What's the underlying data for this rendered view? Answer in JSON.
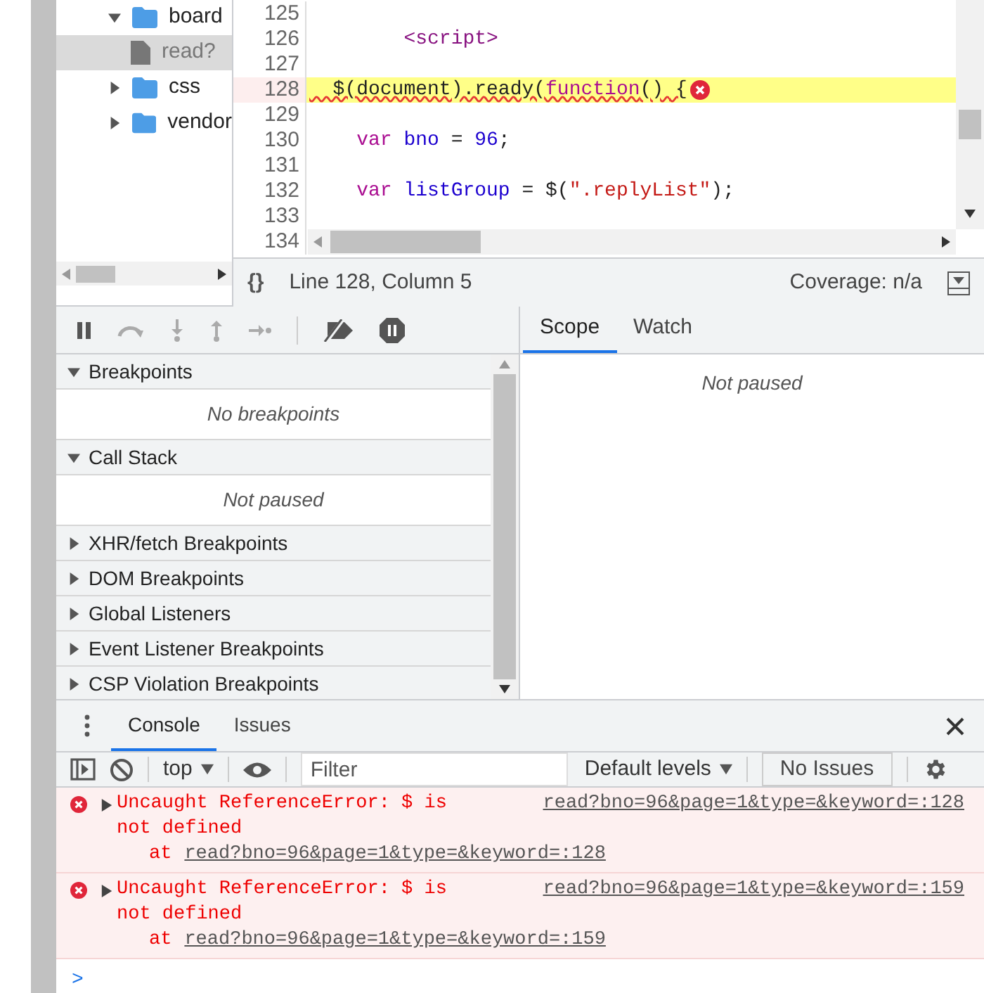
{
  "navigator": {
    "tree": [
      {
        "label": "board",
        "kind": "folder",
        "expanded": true,
        "selected": false,
        "children": [
          {
            "label": "read?",
            "kind": "file",
            "selected": true
          }
        ]
      },
      {
        "label": "css",
        "kind": "folder",
        "expanded": false,
        "selected": false
      },
      {
        "label": "vendor",
        "kind": "folder",
        "expanded": false,
        "selected": false
      }
    ]
  },
  "editor": {
    "lines": [
      {
        "number": "125",
        "highlighted": false
      },
      {
        "number": "126",
        "tokens": [
          {
            "text": "        <script>",
            "kind": "tag"
          }
        ],
        "highlighted": false
      },
      {
        "number": "127",
        "highlighted": false
      },
      {
        "number": "128",
        "tokens": [
          {
            "text": "  $(document).ready(",
            "kind": "plain"
          },
          {
            "text": "function",
            "kind": "keyword"
          },
          {
            "text": "() {",
            "kind": "plain"
          }
        ],
        "highlighted": true,
        "error": true
      },
      {
        "number": "129",
        "highlighted": false
      },
      {
        "number": "130",
        "tokens": [
          {
            "text": "    var",
            "kind": "keyword"
          },
          {
            "text": " bno",
            "kind": "variable"
          },
          {
            "text": " = ",
            "kind": "plain"
          },
          {
            "text": "96",
            "kind": "number"
          },
          {
            "text": ";",
            "kind": "plain"
          }
        ],
        "highlighted": false
      },
      {
        "number": "131",
        "highlighted": false
      },
      {
        "number": "132",
        "tokens": [
          {
            "text": "    var",
            "kind": "keyword"
          },
          {
            "text": " listGroup",
            "kind": "variable"
          },
          {
            "text": " = $(",
            "kind": "plain"
          },
          {
            "text": "\".replyList\"",
            "kind": "string"
          },
          {
            "text": ");",
            "kind": "plain"
          }
        ],
        "highlighted": false
      },
      {
        "number": "133",
        "highlighted": false
      },
      {
        "number": "134",
        "highlighted": false
      }
    ]
  },
  "status_bar": {
    "pretty_print": "{}",
    "position": "Line 128, Column 5",
    "coverage": "Coverage: n/a"
  },
  "debugger": {
    "sections": [
      {
        "title": "Breakpoints",
        "expanded": true,
        "body": "No breakpoints"
      },
      {
        "title": "Call Stack",
        "expanded": true,
        "body": "Not paused"
      },
      {
        "title": "XHR/fetch Breakpoints",
        "expanded": false
      },
      {
        "title": "DOM Breakpoints",
        "expanded": false
      },
      {
        "title": "Global Listeners",
        "expanded": false
      },
      {
        "title": "Event Listener Breakpoints",
        "expanded": false
      },
      {
        "title": "CSP Violation Breakpoints",
        "expanded": false
      }
    ]
  },
  "sidebar_tabs": [
    {
      "label": "Scope",
      "selected": true
    },
    {
      "label": "Watch",
      "selected": false
    }
  ],
  "scope_body": "Not paused",
  "drawer_tabs": [
    {
      "label": "Console",
      "selected": true
    },
    {
      "label": "Issues",
      "selected": false
    }
  ],
  "console_toolbar": {
    "context": "top",
    "filter": {
      "placeholder": "Filter"
    },
    "levels": "Default levels",
    "issues": "No Issues"
  },
  "messages": [
    {
      "text": "Uncaught ReferenceError: $ is not defined",
      "source": "read?bno=96&page=1&type=&keyword=:128",
      "stack_prefix": "at",
      "stack_link": "read?bno=96&page=1&type=&keyword=:128"
    },
    {
      "text": "Uncaught ReferenceError: $ is not defined",
      "source": "read?bno=96&page=1&type=&keyword=:159",
      "stack_prefix": "at",
      "stack_link": "read?bno=96&page=1&type=&keyword=:159"
    }
  ],
  "prompt": ">"
}
